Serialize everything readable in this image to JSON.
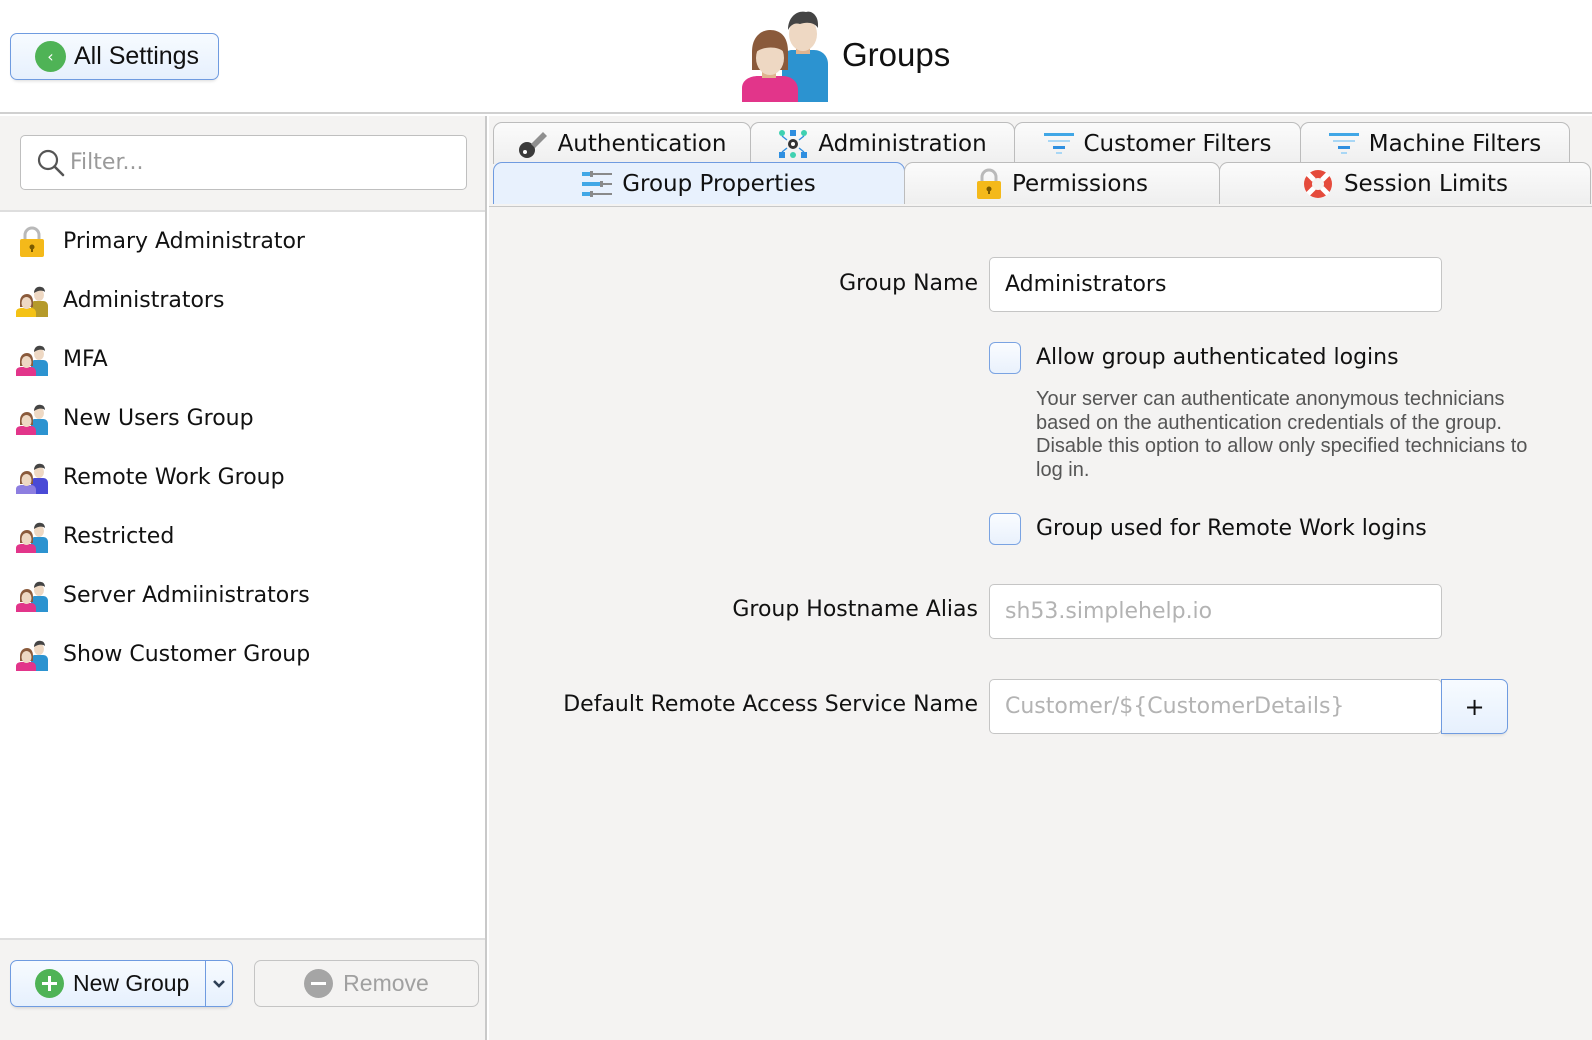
{
  "header": {
    "back_button": "All Settings",
    "title": "Groups"
  },
  "sidebar": {
    "filter_placeholder": "Filter...",
    "groups": [
      {
        "label": "Primary Administrator",
        "icon": "padlock-icon"
      },
      {
        "label": "Administrators",
        "icon": "group-users-icon-gold"
      },
      {
        "label": "MFA",
        "icon": "group-users-icon"
      },
      {
        "label": "New Users Group",
        "icon": "group-users-icon"
      },
      {
        "label": "Remote Work Group",
        "icon": "group-users-icon-purple"
      },
      {
        "label": "Restricted",
        "icon": "group-users-icon"
      },
      {
        "label": "Server Admiinistrators",
        "icon": "group-users-icon"
      },
      {
        "label": "Show Customer Group",
        "icon": "group-users-icon"
      }
    ],
    "new_group_button": "New Group",
    "remove_button": "Remove"
  },
  "tabs": {
    "row1": [
      {
        "label": "Authentication",
        "icon": "key-icon"
      },
      {
        "label": "Administration",
        "icon": "admin-network-gear-icon"
      },
      {
        "label": "Customer Filters",
        "icon": "filter-icon"
      },
      {
        "label": "Machine Filters",
        "icon": "filter-icon"
      }
    ],
    "row2": [
      {
        "label": "Group Properties",
        "icon": "sliders-icon",
        "active": true
      },
      {
        "label": "Permissions",
        "icon": "padlock-icon"
      },
      {
        "label": "Session Limits",
        "icon": "lifebuoy-icon"
      }
    ]
  },
  "form": {
    "group_name_label": "Group Name",
    "group_name_value": "Administrators",
    "allow_group_auth_label": "Allow group authenticated logins",
    "allow_group_auth_checked": false,
    "allow_group_auth_help": "Your server can authenticate anonymous technicians based on the authentication credentials of the group. Disable this option to allow only specified technicians to log in.",
    "remote_work_label": "Group used for Remote Work logins",
    "remote_work_checked": false,
    "hostname_alias_label": "Group Hostname Alias",
    "hostname_alias_placeholder": "sh53.simplehelp.io",
    "service_name_label": "Default Remote Access Service Name",
    "service_name_placeholder": "Customer/${CustomerDetails}",
    "add_variable_button": "+"
  },
  "colors": {
    "accent_blue": "#6f9be0",
    "green": "#4fb356",
    "panel_bg": "#f4f3f2"
  }
}
